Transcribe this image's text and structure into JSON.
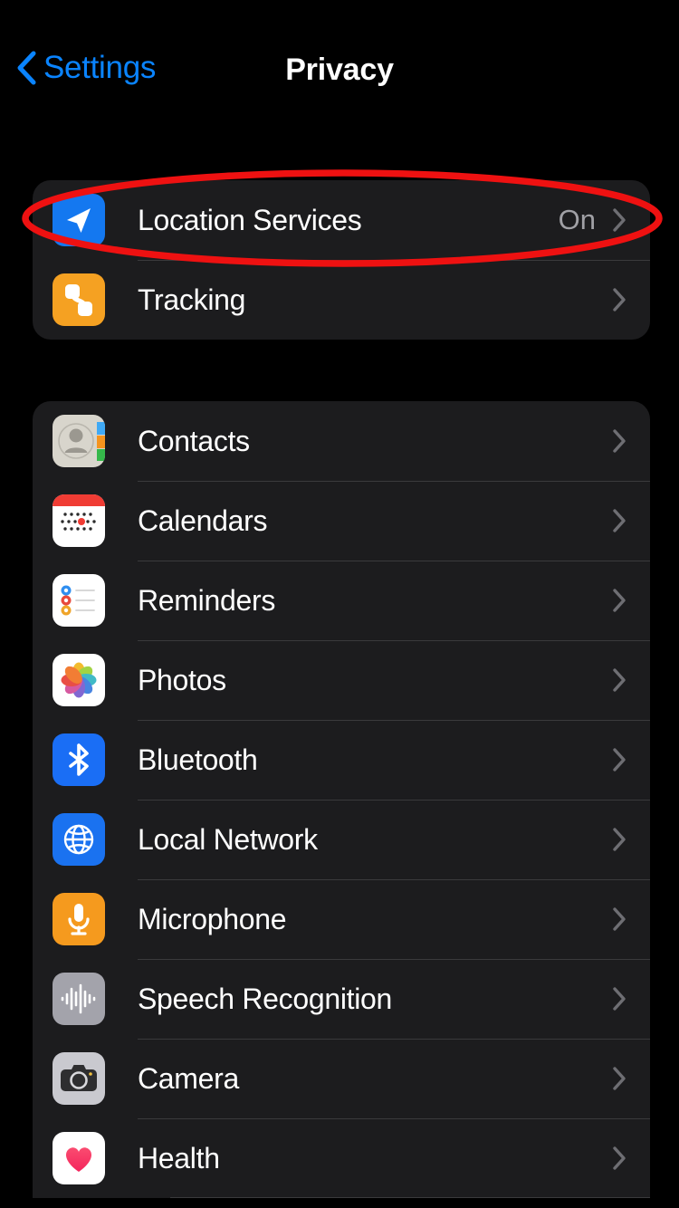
{
  "nav": {
    "back_label": "Settings",
    "back_icon": "chevron-left-icon",
    "title": "Privacy"
  },
  "colors": {
    "accent_blue": "#0a84ff",
    "card_bg": "#1c1c1e",
    "screen_bg": "#000000",
    "separator": "#3a3a3c",
    "value_text": "#a0a0a5",
    "annotation_red": "#ee1111"
  },
  "annotation": {
    "shape": "ellipse",
    "target": "Location Services",
    "color": "#ee1111"
  },
  "groups": [
    {
      "id": "primary",
      "rows": [
        {
          "label": "Location Services",
          "value": "On",
          "icon": "location-arrow-icon",
          "chevron": "chevron-right-icon"
        },
        {
          "label": "Tracking",
          "value": "",
          "icon": "tracking-icon",
          "chevron": "chevron-right-icon"
        }
      ]
    },
    {
      "id": "apps",
      "rows": [
        {
          "label": "Contacts",
          "value": "",
          "icon": "contacts-icon",
          "chevron": "chevron-right-icon"
        },
        {
          "label": "Calendars",
          "value": "",
          "icon": "calendars-icon",
          "chevron": "chevron-right-icon"
        },
        {
          "label": "Reminders",
          "value": "",
          "icon": "reminders-icon",
          "chevron": "chevron-right-icon"
        },
        {
          "label": "Photos",
          "value": "",
          "icon": "photos-icon",
          "chevron": "chevron-right-icon"
        },
        {
          "label": "Bluetooth",
          "value": "",
          "icon": "bluetooth-icon",
          "chevron": "chevron-right-icon"
        },
        {
          "label": "Local Network",
          "value": "",
          "icon": "local-network-icon",
          "chevron": "chevron-right-icon"
        },
        {
          "label": "Microphone",
          "value": "",
          "icon": "microphone-icon",
          "chevron": "chevron-right-icon"
        },
        {
          "label": "Speech Recognition",
          "value": "",
          "icon": "speech-recognition-icon",
          "chevron": "chevron-right-icon"
        },
        {
          "label": "Camera",
          "value": "",
          "icon": "camera-icon",
          "chevron": "chevron-right-icon"
        },
        {
          "label": "Health",
          "value": "",
          "icon": "health-icon",
          "chevron": "chevron-right-icon"
        }
      ]
    }
  ]
}
